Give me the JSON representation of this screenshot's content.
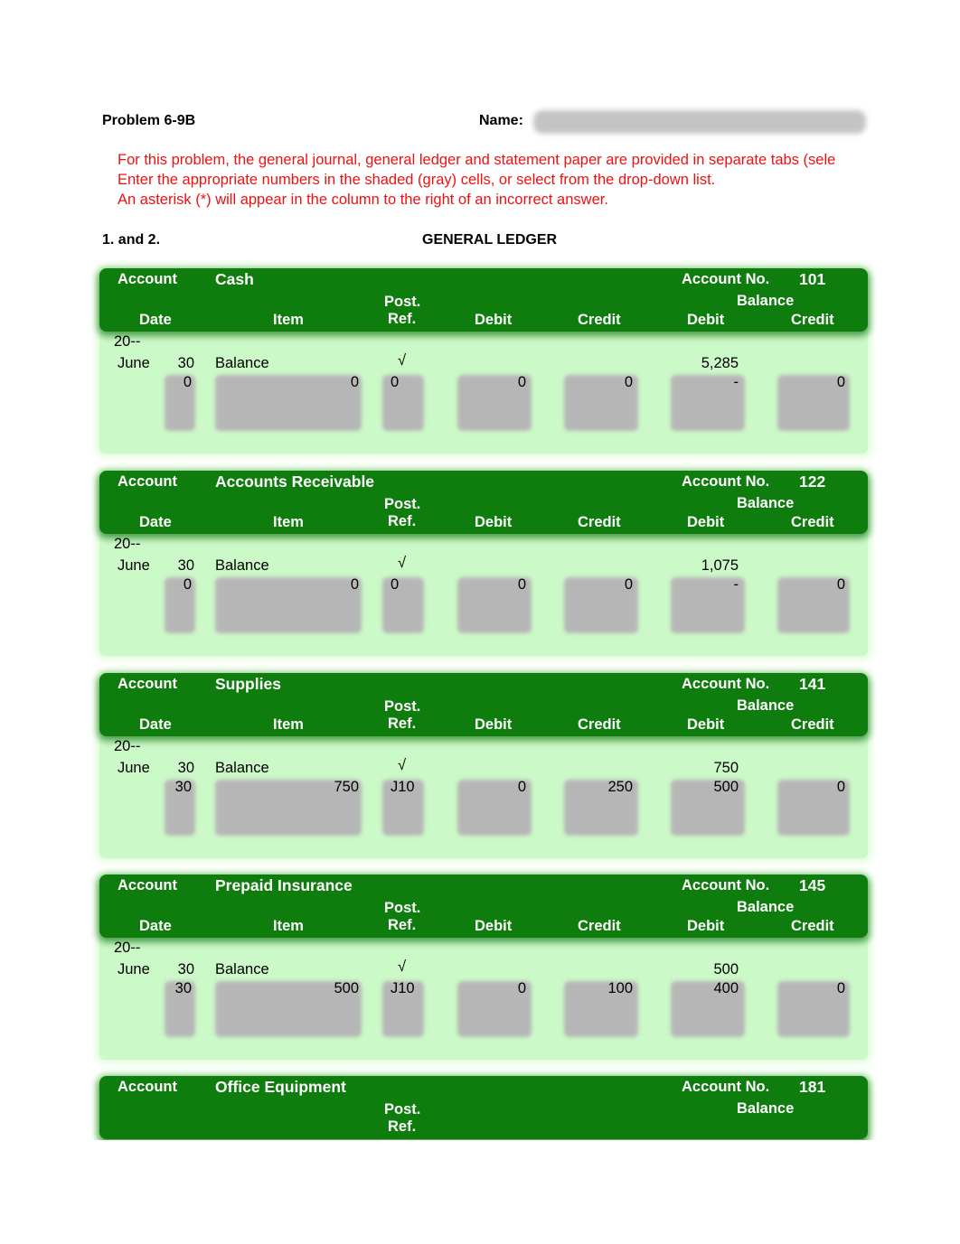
{
  "header": {
    "problem_title": "Problem 6-9B",
    "name_label": "Name:",
    "name_value": ""
  },
  "instructions": [
    "For this problem, the general journal, general ledger and statement paper are provided in separate tabs (sele",
    "Enter the appropriate numbers in the shaded (gray) cells, or select from the drop-down list.",
    "An asterisk (*) will appear in the column to the right of an incorrect answer."
  ],
  "section": {
    "label": "1. and 2.",
    "title": "GENERAL LEDGER"
  },
  "column_labels": {
    "account": "Account",
    "account_no": "Account No.",
    "balance": "Balance",
    "post": "Post.",
    "ref": "Ref.",
    "date": "Date",
    "item": "Item",
    "debit": "Debit",
    "credit": "Credit",
    "bal_debit": "Debit",
    "bal_credit": "Credit"
  },
  "accounts": [
    {
      "name": "Cash",
      "number": "101",
      "year": "20--",
      "opening": {
        "month": "June",
        "day": "30",
        "item": "Balance",
        "ref": "√",
        "bal_debit": "5,285"
      },
      "entry": {
        "day": "0",
        "item": "0",
        "ref": "0",
        "debit": "0",
        "credit": "0",
        "bal_debit": "-",
        "bal_credit": "0"
      }
    },
    {
      "name": "Accounts Receivable",
      "number": "122",
      "year": "20--",
      "opening": {
        "month": "June",
        "day": "30",
        "item": "Balance",
        "ref": "√",
        "bal_debit": "1,075"
      },
      "entry": {
        "day": "0",
        "item": "0",
        "ref": "0",
        "debit": "0",
        "credit": "0",
        "bal_debit": "-",
        "bal_credit": "0"
      }
    },
    {
      "name": "Supplies",
      "number": "141",
      "year": "20--",
      "opening": {
        "month": "June",
        "day": "30",
        "item": "Balance",
        "ref": "√",
        "bal_debit": "750"
      },
      "entry": {
        "day": "30",
        "item": "750",
        "ref": "J10",
        "debit": "0",
        "credit": "250",
        "bal_debit": "500",
        "bal_credit": "0"
      }
    },
    {
      "name": "Prepaid Insurance",
      "number": "145",
      "year": "20--",
      "opening": {
        "month": "June",
        "day": "30",
        "item": "Balance",
        "ref": "√",
        "bal_debit": "500"
      },
      "entry": {
        "day": "30",
        "item": "500",
        "ref": "J10",
        "debit": "0",
        "credit": "100",
        "bal_debit": "400",
        "bal_credit": "0"
      }
    },
    {
      "name": "Office Equipment",
      "number": "181"
    }
  ]
}
